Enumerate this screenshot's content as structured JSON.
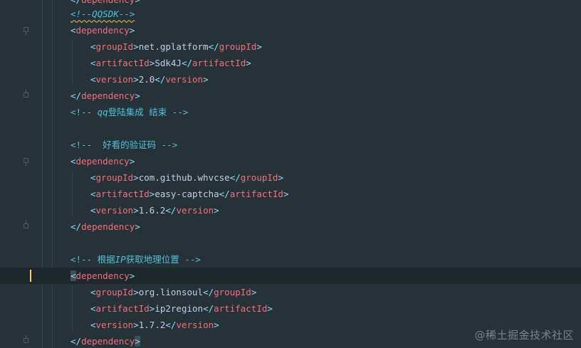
{
  "editor": {
    "language": "xml",
    "colors": {
      "background": "#263238",
      "current_line": "#1e272c",
      "bracket": "#89ddff",
      "tag": "#f07178",
      "text": "#c3cee3",
      "comment": "#4fc1d9",
      "caret_marker": "#ffcb6b"
    }
  },
  "lines": {
    "l0": {
      "close": "</",
      "tag": "dependency",
      "end": ">"
    },
    "l1": {
      "comment": "<!--QQSDK-->"
    },
    "l2": {
      "open": "<",
      "tag": "dependency",
      "end": ">"
    },
    "l3": {
      "o1": "<",
      "t1": "groupId",
      "e1": ">",
      "value": "net.gplatform",
      "o2": "</",
      "t2": "groupId",
      "e2": ">"
    },
    "l4": {
      "o1": "<",
      "t1": "artifactId",
      "e1": ">",
      "value": "Sdk4J",
      "o2": "</",
      "t2": "artifactId",
      "e2": ">"
    },
    "l5": {
      "o1": "<",
      "t1": "version",
      "e1": ">",
      "value": "2.0",
      "o2": "</",
      "t2": "version",
      "e2": ">"
    },
    "l6": {
      "close": "</",
      "tag": "dependency",
      "end": ">"
    },
    "l7": {
      "comment_start": "<!-- ",
      "comment_italic": "qq",
      "comment_rest": "登陆集成 结束 -->"
    },
    "l9": {
      "comment": "<!--  好看的验证码 -->"
    },
    "l10": {
      "open": "<",
      "tag": "dependency",
      "end": ">"
    },
    "l11": {
      "o1": "<",
      "t1": "groupId",
      "e1": ">",
      "value": "com.github.whvcse",
      "o2": "</",
      "t2": "groupId",
      "e2": ">"
    },
    "l12": {
      "o1": "<",
      "t1": "artifactId",
      "e1": ">",
      "value": "easy-captcha",
      "o2": "</",
      "t2": "artifactId",
      "e2": ">"
    },
    "l13": {
      "o1": "<",
      "t1": "version",
      "e1": ">",
      "value": "1.6.2",
      "o2": "</",
      "t2": "version",
      "e2": ">"
    },
    "l14": {
      "close": "</",
      "tag": "dependency",
      "end": ">"
    },
    "l16": {
      "comment_start": "<!-- 根据",
      "comment_italic": "IP",
      "comment_rest": "获取地理位置 -->"
    },
    "l17": {
      "open": "<",
      "tag": "dependency",
      "end": ">"
    },
    "l18": {
      "o1": "<",
      "t1": "groupId",
      "e1": ">",
      "value": "org.lionsoul",
      "o2": "</",
      "t2": "groupId",
      "e2": ">"
    },
    "l19": {
      "o1": "<",
      "t1": "artifactId",
      "e1": ">",
      "value": "ip2region",
      "o2": "</",
      "t2": "artifactId",
      "e2": ">"
    },
    "l20": {
      "o1": "<",
      "t1": "version",
      "e1": ">",
      "value": "1.7.2",
      "o2": "</",
      "t2": "version",
      "e2": ">"
    },
    "l21": {
      "close": "</",
      "tag": "dependency",
      "end": ">"
    }
  },
  "watermark": "@稀土掘金技术社区"
}
